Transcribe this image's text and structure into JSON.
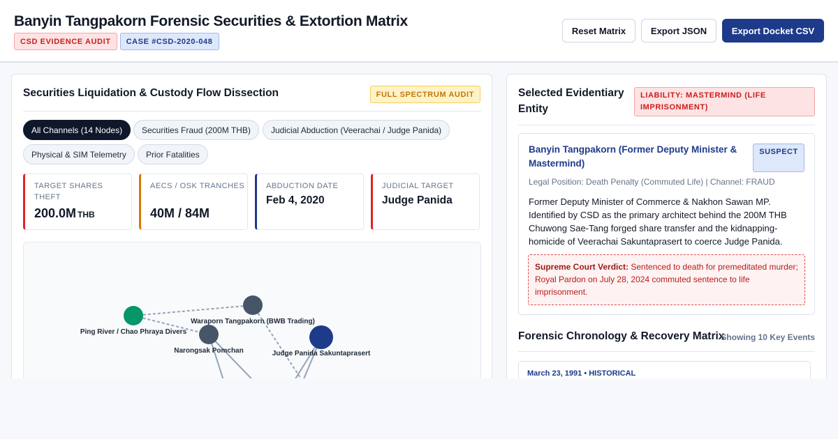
{
  "header": {
    "title": "Banyin Tangpakorn Forensic Securities & Extortion Matrix",
    "badges": [
      "CSD EVIDENCE AUDIT",
      "CASE #CSD-2020-048"
    ],
    "buttons": {
      "reset": "Reset Matrix",
      "export_json": "Export JSON",
      "export_csv": "Export Docket CSV"
    }
  },
  "left_panel": {
    "title": "Securities Liquidation & Custody Flow Dissection",
    "audit_badge": "FULL SPECTRUM AUDIT",
    "filters": [
      "All Channels (14 Nodes)",
      "Securities Fraud (200M THB)",
      "Judicial Abduction (Veerachai / Judge Panida)",
      "Physical & SIM Telemetry",
      "Prior Fatalities"
    ],
    "active_filter": 0,
    "stats": [
      {
        "label": "TARGET SHARES THEFT",
        "value": "200.0M",
        "unit": "THB",
        "color": "#dc2626"
      },
      {
        "label": "AECS / OSK TRANCHES",
        "value": "40M / 84M",
        "unit": "",
        "color": "#d97706"
      },
      {
        "label": "ABDUCTION DATE",
        "value": "Feb 4, 2020",
        "unit": "",
        "color": "#1e3a8a"
      },
      {
        "label": "JUDICIAL TARGET",
        "value": "Judge Panida",
        "unit": "",
        "color": "#dc2626"
      }
    ],
    "graph_nodes": [
      {
        "label": "Ping River / Chao Phraya Divers",
        "color": "#059669"
      },
      {
        "label": "Waraporn Tangpakorn (BWB Trading)",
        "color": "#475569"
      },
      {
        "label": "Narongsak Pomchan",
        "color": "#475569"
      },
      {
        "label": "Judge Panida Sakuntaprasert",
        "color": "#1e3a8a"
      }
    ]
  },
  "right_panel": {
    "title": "Selected Evidentiary Entity",
    "liability_badge": "LIABILITY: MASTERMIND (LIFE IMPRISONMENT)",
    "entity": {
      "name": "Banyin Tangpakorn (Former Deputy Minister & Mastermind)",
      "tag": "SUSPECT",
      "meta": "Legal Position: Death Penalty (Commuted Life) | Channel: FRAUD",
      "description": "Former Deputy Minister of Commerce & Nakhon Sawan MP. Identified by CSD as the primary architect behind the 200M THB Chuwong Sae-Tang forged share transfer and the kidnapping-homicide of Veerachai Sakuntaprasert to coerce Judge Panida.",
      "verdict_label": "Supreme Court Verdict:",
      "verdict_text": "Sentenced to death for premeditated murder; Royal Pardon on July 28, 2024 commuted sentence to life imprisonment."
    },
    "chronology": {
      "title": "Forensic Chronology & Recovery Matrix",
      "count": "Showing 10 Key Events",
      "items": [
        {
          "date": "March 23, 1991 • HISTORICAL"
        }
      ]
    }
  }
}
